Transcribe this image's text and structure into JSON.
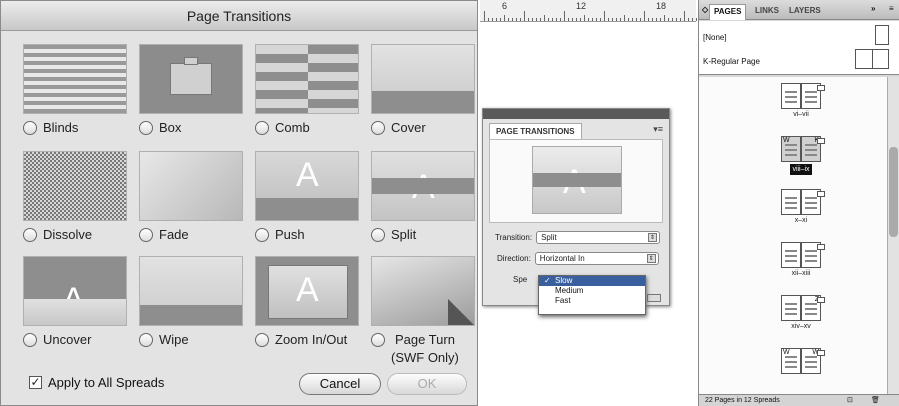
{
  "dialog": {
    "title": "Page Transitions",
    "options": [
      {
        "label": "Blinds"
      },
      {
        "label": "Box"
      },
      {
        "label": "Comb"
      },
      {
        "label": "Cover"
      },
      {
        "label": "Dissolve"
      },
      {
        "label": "Fade"
      },
      {
        "label": "Push"
      },
      {
        "label": "Split"
      },
      {
        "label": "Uncover"
      },
      {
        "label": "Wipe"
      },
      {
        "label": "Zoom In/Out"
      },
      {
        "label": "Page Turn",
        "label2": "(SWF Only)"
      }
    ],
    "preview_glyph": "A",
    "apply_label": "Apply to All Spreads",
    "apply_checked": true,
    "cancel_label": "Cancel",
    "ok_label": "OK"
  },
  "ruler": {
    "numbers": [
      "6",
      "12",
      "18"
    ]
  },
  "transitions_panel": {
    "tab": "PAGE TRANSITIONS",
    "transition_label": "Transition:",
    "transition_value": "Split",
    "direction_label": "Direction:",
    "direction_value": "Horizontal In",
    "speed_label": "Spe",
    "speed_options": [
      {
        "label": "Slow",
        "checked": true
      },
      {
        "label": "Medium",
        "checked": false
      },
      {
        "label": "Fast",
        "checked": false
      }
    ],
    "menu_icon": "panel-menu-icon"
  },
  "pages_panel": {
    "tabs": [
      "PAGES",
      "LINKS",
      "LAYERS"
    ],
    "masters": [
      "[None]",
      "K-Regular Page"
    ],
    "spreads": [
      {
        "label": "vi–vii",
        "left": "",
        "right": "",
        "selected": false
      },
      {
        "label": "viii–ix",
        "left": "W",
        "right": "K",
        "selected": true
      },
      {
        "label": "x–xi",
        "left": "",
        "right": "",
        "selected": false
      },
      {
        "label": "xii–xiii",
        "left": "",
        "right": "",
        "selected": false
      },
      {
        "label": "xiv–xv",
        "left": "",
        "right": "Z",
        "selected": false
      },
      {
        "label": "",
        "left": "W",
        "right": "W",
        "selected": false
      }
    ],
    "footer": "22 Pages in 12 Spreads"
  },
  "colors": {
    "dialog_bg": "#e3e3e3",
    "thumb_gray": "#8f8f8f",
    "menu_highlight": "#3a5f9e"
  }
}
